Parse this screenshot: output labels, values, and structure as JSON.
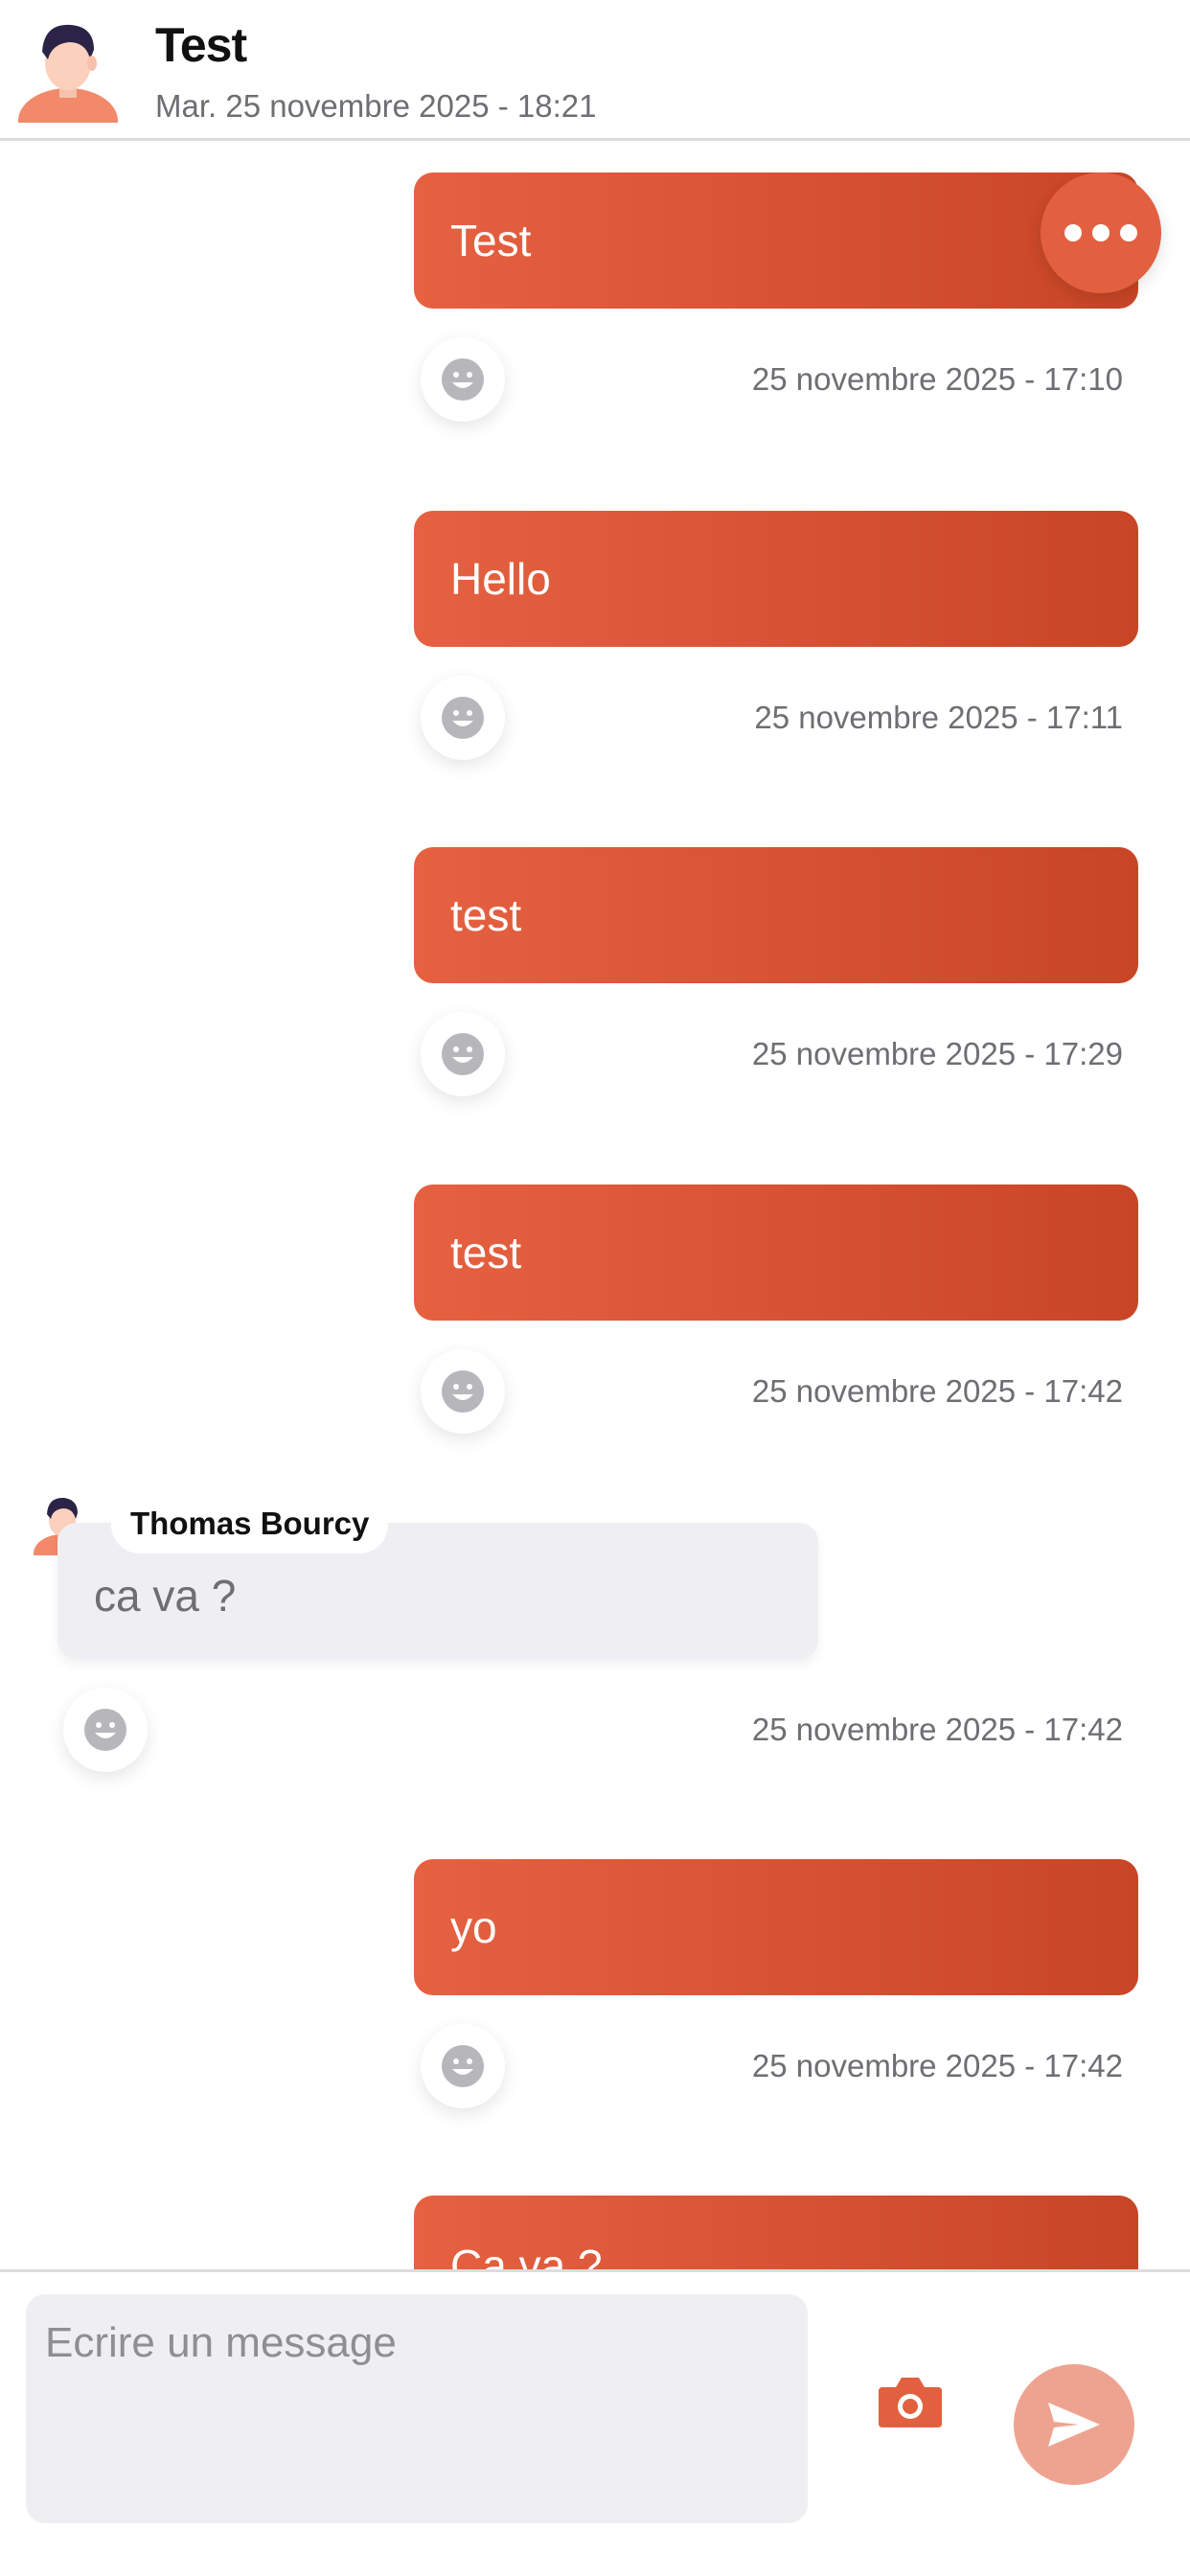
{
  "header": {
    "title": "Test",
    "subtitle": "Mar. 25 novembre 2025 - 18:21",
    "avatar_icon": "user-avatar-icon",
    "more_icon": "more-dots-icon"
  },
  "messages": [
    {
      "direction": "out",
      "text": "Test",
      "time": "25 novembre 2025 - 17:10"
    },
    {
      "direction": "out",
      "text": "Hello",
      "time": "25 novembre 2025 - 17:11"
    },
    {
      "direction": "out",
      "text": "test",
      "time": "25 novembre 2025 - 17:29"
    },
    {
      "direction": "out",
      "text": "test",
      "time": "25 novembre 2025 - 17:42"
    },
    {
      "direction": "in",
      "sender": "Thomas Bourcy",
      "text": "ca va ?",
      "time": "25 novembre 2025 - 17:42"
    },
    {
      "direction": "out",
      "text": "yo",
      "time": "25 novembre 2025 - 17:42"
    },
    {
      "direction": "out",
      "text": "Ca va ?",
      "time": ""
    }
  ],
  "composer": {
    "placeholder": "Ecrire un message",
    "camera_icon": "camera-icon",
    "send_icon": "send-icon"
  },
  "colors": {
    "accent": "#e2603f",
    "bubble_out_start": "#e66141",
    "bubble_out_end": "#c84526",
    "bubble_in": "#efeff3",
    "send_button": "#eea390"
  }
}
